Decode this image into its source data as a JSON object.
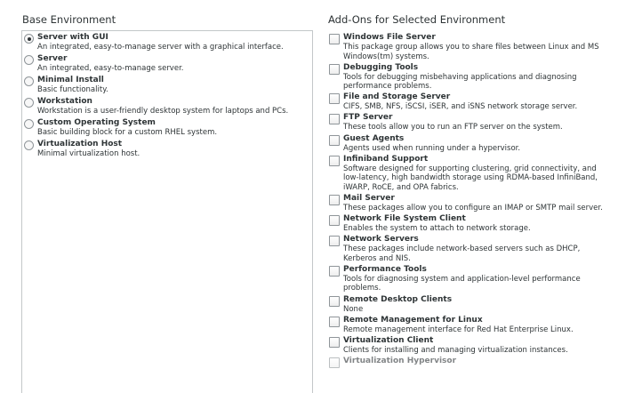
{
  "base_environment": {
    "title": "Base Environment",
    "items": [
      {
        "name": "Server with GUI",
        "desc": "An integrated, easy-to-manage server with a graphical interface.",
        "selected": true
      },
      {
        "name": "Server",
        "desc": "An integrated, easy-to-manage server.",
        "selected": false
      },
      {
        "name": "Minimal Install",
        "desc": "Basic functionality.",
        "selected": false
      },
      {
        "name": "Workstation",
        "desc": "Workstation is a user-friendly desktop system for laptops and PCs.",
        "selected": false
      },
      {
        "name": "Custom Operating System",
        "desc": "Basic building block for a custom RHEL system.",
        "selected": false
      },
      {
        "name": "Virtualization Host",
        "desc": "Minimal virtualization host.",
        "selected": false
      }
    ]
  },
  "addons": {
    "title": "Add-Ons for Selected Environment",
    "items": [
      {
        "name": "Windows File Server",
        "desc": "This package group allows you to share files between Linux and MS Windows(tm) systems.",
        "checked": false
      },
      {
        "name": "Debugging Tools",
        "desc": "Tools for debugging misbehaving applications and diagnosing performance problems.",
        "checked": false
      },
      {
        "name": "File and Storage Server",
        "desc": "CIFS, SMB, NFS, iSCSI, iSER, and iSNS network storage server.",
        "checked": false
      },
      {
        "name": "FTP Server",
        "desc": "These tools allow you to run an FTP server on the system.",
        "checked": false
      },
      {
        "name": "Guest Agents",
        "desc": "Agents used when running under a hypervisor.",
        "checked": false
      },
      {
        "name": "Infiniband Support",
        "desc": "Software designed for supporting clustering, grid connectivity, and low-latency, high bandwidth storage using RDMA-based InfiniBand, iWARP, RoCE, and OPA fabrics.",
        "checked": false
      },
      {
        "name": "Mail Server",
        "desc": "These packages allow you to configure an IMAP or SMTP mail server.",
        "checked": false
      },
      {
        "name": "Network File System Client",
        "desc": "Enables the system to attach to network storage.",
        "checked": false
      },
      {
        "name": "Network Servers",
        "desc": "These packages include network-based servers such as DHCP, Kerberos and NIS.",
        "checked": false
      },
      {
        "name": "Performance Tools",
        "desc": "Tools for diagnosing system and application-level performance problems.",
        "checked": false
      },
      {
        "name": "Remote Desktop Clients",
        "desc": "None",
        "checked": false
      },
      {
        "name": "Remote Management for Linux",
        "desc": "Remote management interface for Red Hat Enterprise Linux.",
        "checked": false
      },
      {
        "name": "Virtualization Client",
        "desc": "Clients for installing and managing virtualization instances.",
        "checked": false
      },
      {
        "name": "Virtualization Hypervisor",
        "desc": "",
        "checked": false
      }
    ]
  }
}
